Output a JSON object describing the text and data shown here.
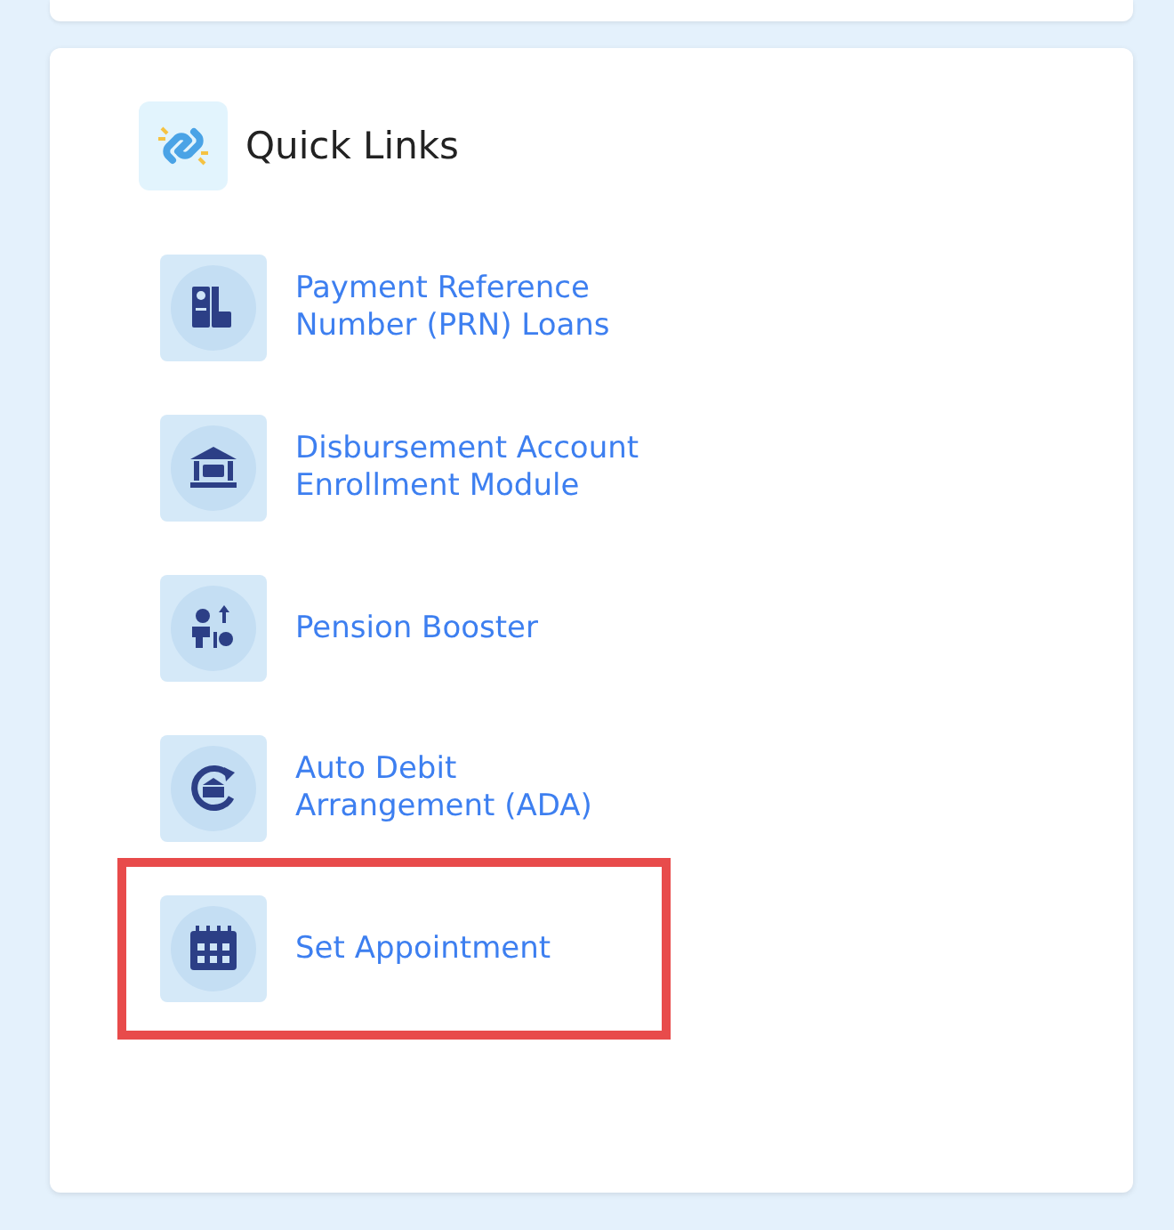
{
  "panel": {
    "title": "Quick Links"
  },
  "links": [
    {
      "label": "Payment Reference Number (PRN) Loans",
      "kind": "prn",
      "highlighted": false
    },
    {
      "label": "Disbursement Account Enrollment Module",
      "kind": "bank",
      "highlighted": false
    },
    {
      "label": "Pension Booster",
      "kind": "booster",
      "highlighted": false
    },
    {
      "label": "Auto Debit Arrangement (ADA)",
      "kind": "ada",
      "highlighted": false
    },
    {
      "label": "Set Appointment",
      "kind": "calendar",
      "highlighted": true
    }
  ]
}
